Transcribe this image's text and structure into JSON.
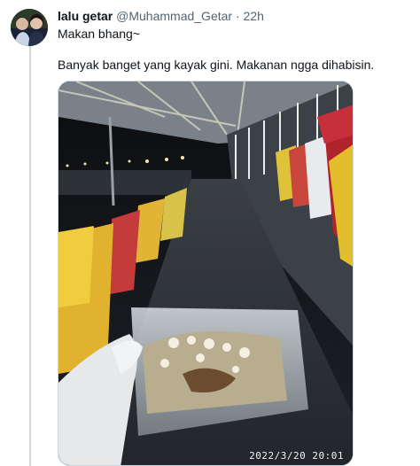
{
  "tweet": {
    "display_name": "lalu getar",
    "handle": "@Muhammad_Getar",
    "separator": "·",
    "time": "22h",
    "text_line1": "Makan bhang~",
    "text_line2": "Banyak banget yang kayak gini. Makanan ngga dihabisin.",
    "avatar_icon": "profile-photo",
    "thread_line_color": "#cfd9de"
  },
  "photo": {
    "timestamp": "2022/3/20  20:01",
    "subject": "stadium-seats-with-food-container"
  }
}
